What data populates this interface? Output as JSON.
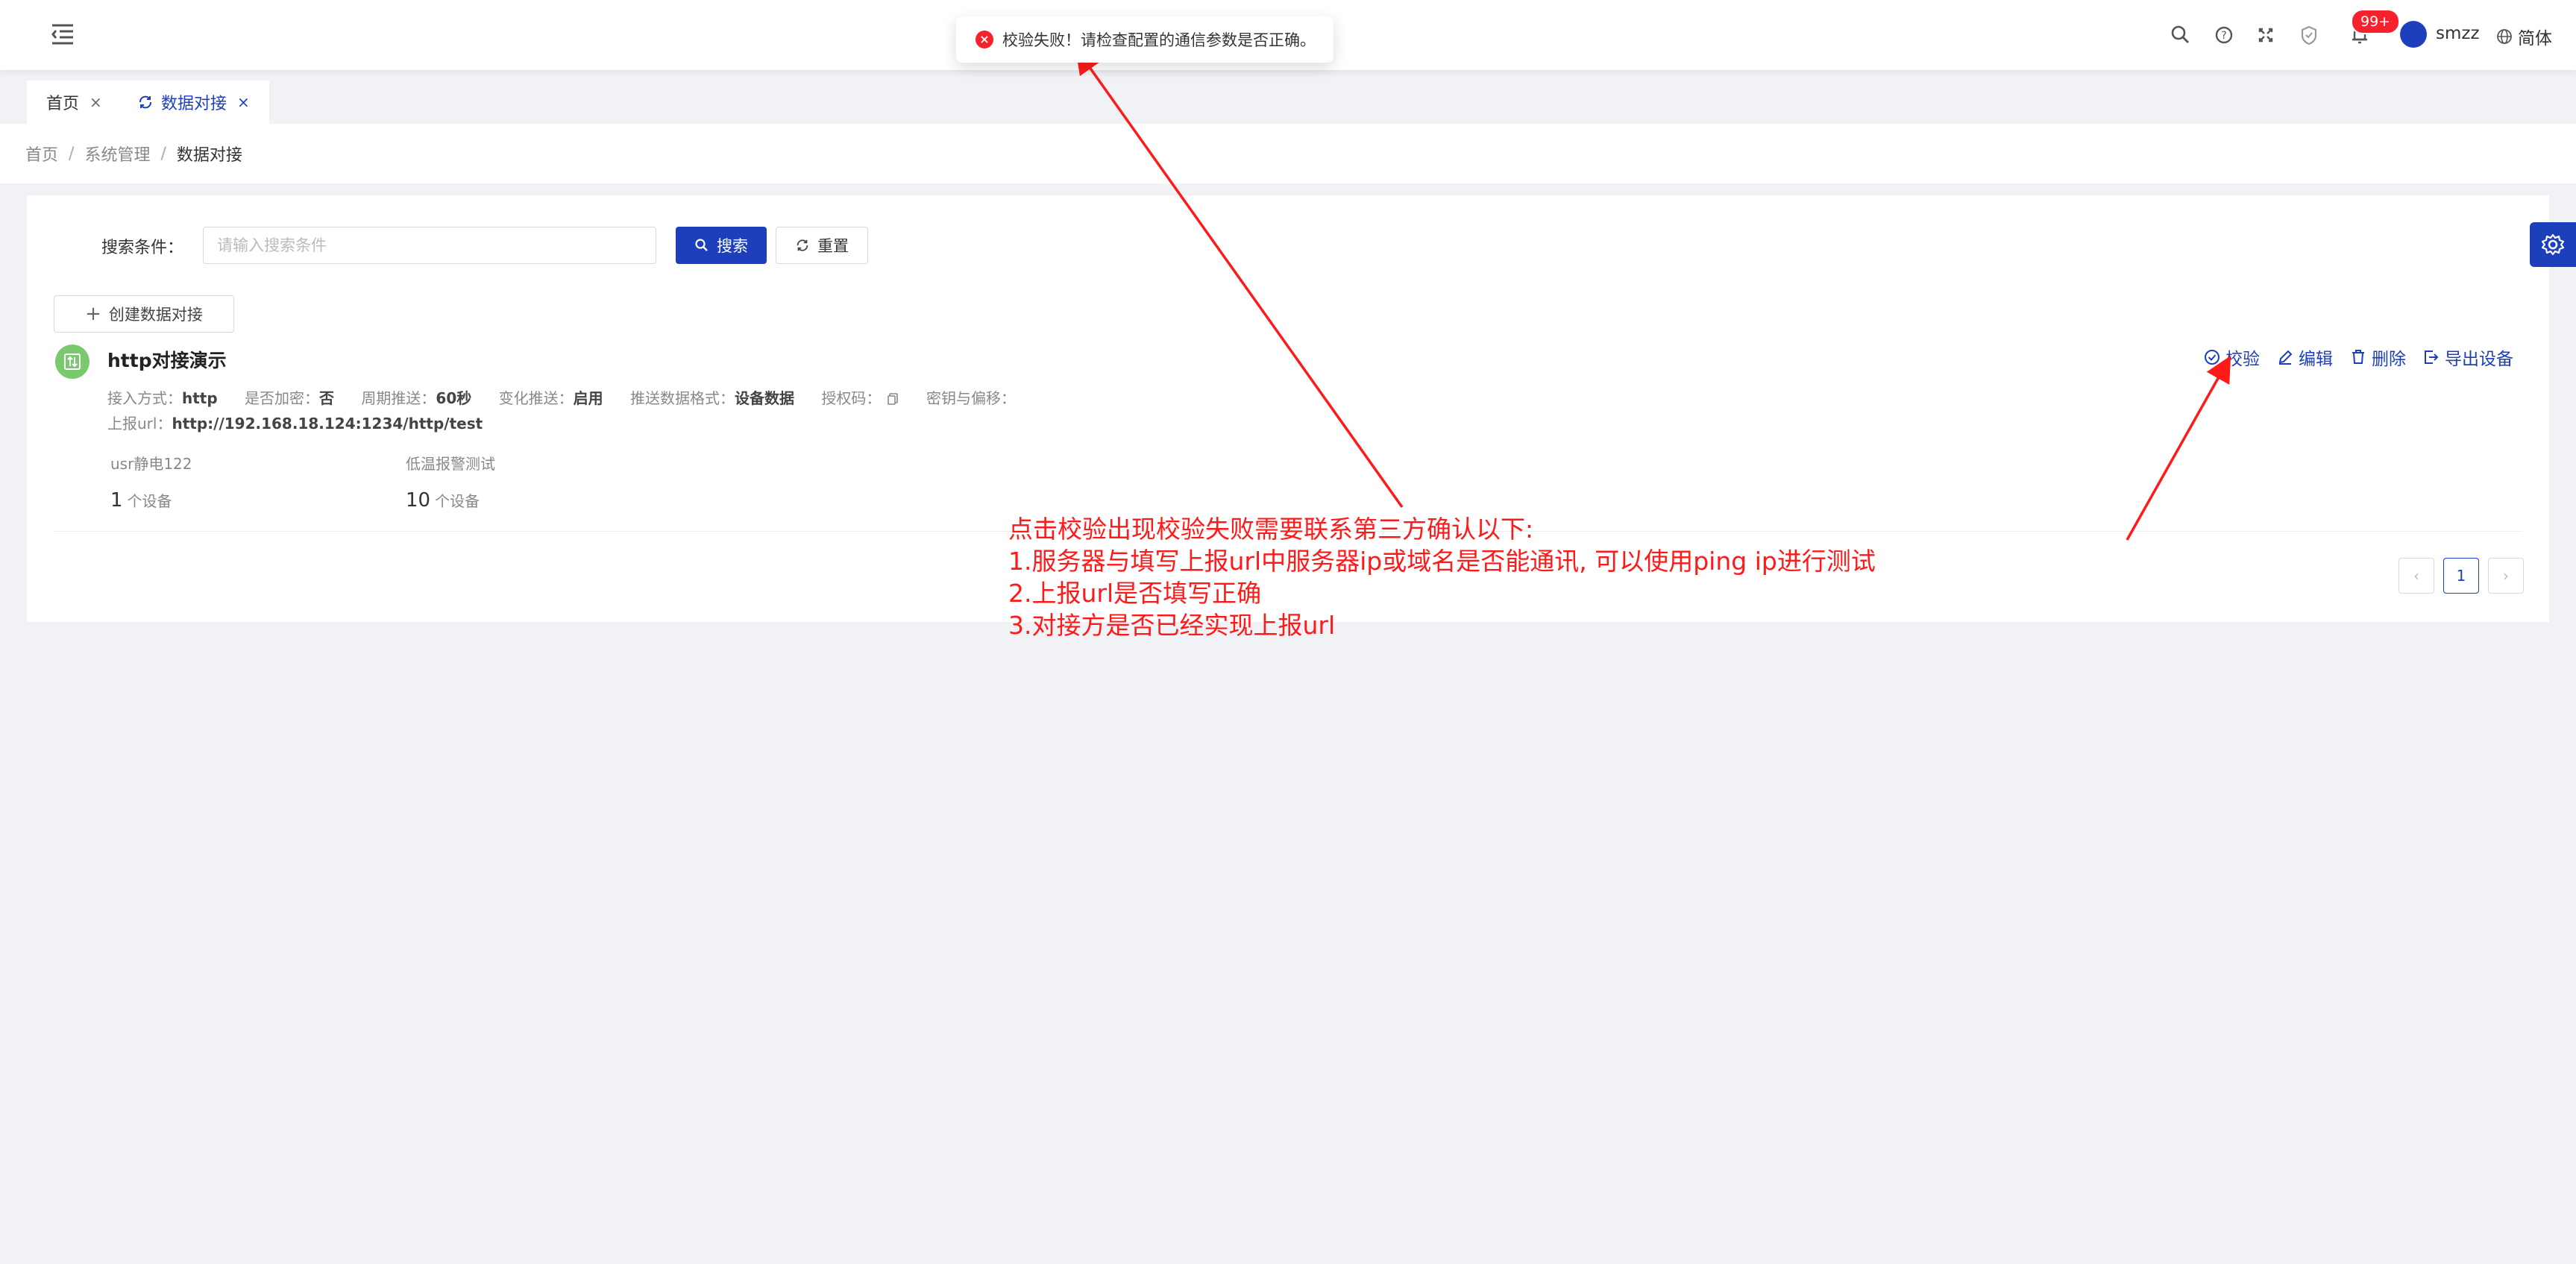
{
  "toast": {
    "message": "校验失败！请检查配置的通信参数是否正确。"
  },
  "header": {
    "badge": "99+",
    "username": "smzz",
    "language": "简体",
    "icons": [
      "search-icon",
      "help-icon",
      "fullscreen-icon",
      "shield-icon",
      "bell-icon"
    ]
  },
  "tabs": [
    {
      "label": "首页"
    },
    {
      "label": "数据对接"
    }
  ],
  "breadcrumb": [
    "首页",
    "系统管理",
    "数据对接"
  ],
  "search": {
    "label": "搜索条件：",
    "placeholder": "请输入搜索条件",
    "search_button": "搜索",
    "reset_button": "重置"
  },
  "create_button": "创建数据对接",
  "item": {
    "title": "http对接演示",
    "meta": {
      "access_label": "接入方式：",
      "access_value": "http",
      "encrypt_label": "是否加密：",
      "encrypt_value": "否",
      "period_label": "周期推送：",
      "period_value": "60秒",
      "change_label": "变化推送：",
      "change_value": "启用",
      "format_label": "推送数据格式：",
      "format_value": "设备数据",
      "auth_label": "授权码：",
      "key_label": "密钥与偏移："
    },
    "url_label": "上报url：",
    "url_value": "http://192.168.18.124:1234/http/test",
    "groups": [
      {
        "name": "usr静电122",
        "count": "1",
        "unit": "个设备"
      },
      {
        "name": "低温报警测试",
        "count": "10",
        "unit": "个设备"
      }
    ],
    "actions": [
      "校验",
      "编辑",
      "删除",
      "导出设备"
    ]
  },
  "pagination": {
    "current": "1"
  },
  "annotation": {
    "lines": [
      "点击校验出现校验失败需要联系第三方确认以下:",
      "1.服务器与填写上报url中服务器ip或域名是否能通讯, 可以使用ping ip进行测试",
      "2.上报url是否填写正确",
      "3.对接方是否已经实现上报url"
    ]
  },
  "colors": {
    "primary": "#1d3fbb",
    "danger": "#f5222d",
    "annotation": "#ff1a1a"
  }
}
